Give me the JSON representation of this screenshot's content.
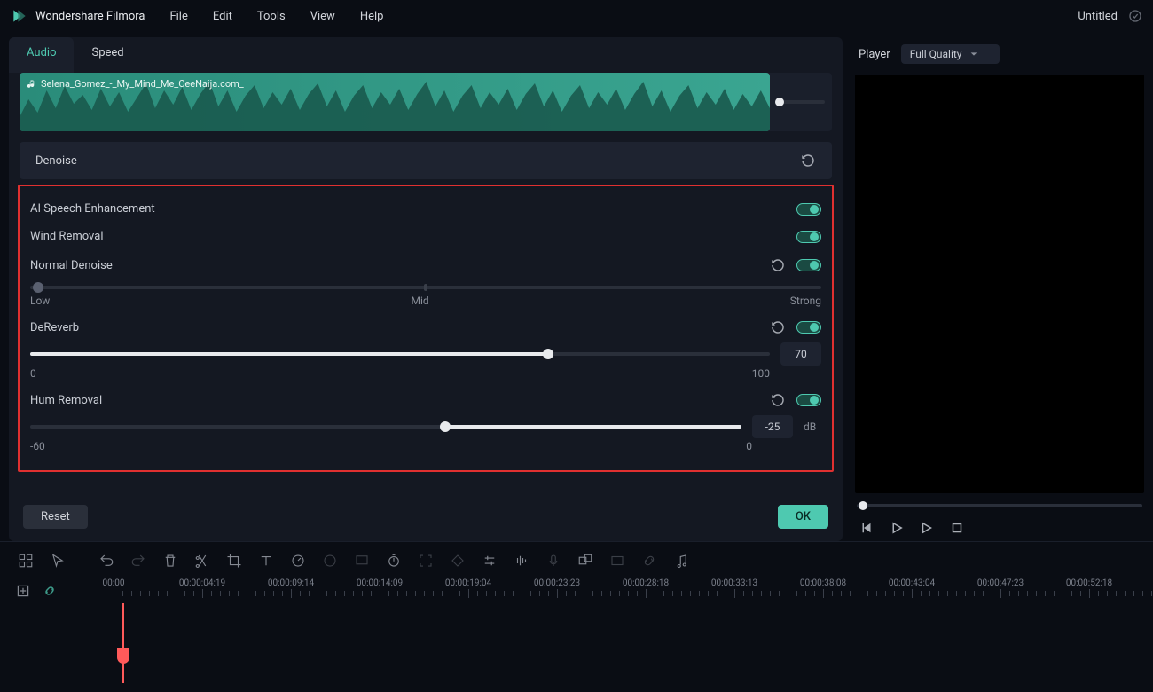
{
  "app": {
    "title": "Wondershare Filmora"
  },
  "menu": {
    "file": "File",
    "edit": "Edit",
    "tools": "Tools",
    "view": "View",
    "help": "Help"
  },
  "doc": {
    "title": "Untitled"
  },
  "tabs": {
    "audio": "Audio",
    "speed": "Speed"
  },
  "clip": {
    "filename": "Selena_Gomez_-_My_Mind_Me_CeeNaija.com_"
  },
  "denoise": {
    "header": "Denoise",
    "ai_speech": {
      "label": "AI Speech Enhancement",
      "on": true
    },
    "wind": {
      "label": "Wind Removal",
      "on": true
    },
    "normal": {
      "label": "Normal Denoise",
      "on": true,
      "low": "Low",
      "mid": "Mid",
      "strong": "Strong"
    },
    "dereverb": {
      "label": "DeReverb",
      "on": true,
      "value": "70",
      "min": "0",
      "max": "100"
    },
    "hum": {
      "label": "Hum Removal",
      "on": true,
      "value": "-25",
      "unit": "dB",
      "min": "-60",
      "max": "0"
    }
  },
  "footer": {
    "reset": "Reset",
    "ok": "OK"
  },
  "player": {
    "label": "Player",
    "quality": "Full Quality"
  },
  "timeline": {
    "marks": [
      {
        "t": "00:00",
        "pos": 0
      },
      {
        "t": "00:00:04:19",
        "pos": 100
      },
      {
        "t": "00:00:09:14",
        "pos": 200
      },
      {
        "t": "00:00:14:09",
        "pos": 300
      },
      {
        "t": "00:00:19:04",
        "pos": 400
      },
      {
        "t": "00:00:23:23",
        "pos": 500
      },
      {
        "t": "00:00:28:18",
        "pos": 600
      },
      {
        "t": "00:00:33:13",
        "pos": 700
      },
      {
        "t": "00:00:38:08",
        "pos": 800
      },
      {
        "t": "00:00:43:04",
        "pos": 900
      },
      {
        "t": "00:00:47:23",
        "pos": 1000
      },
      {
        "t": "00:00:52:18",
        "pos": 1100
      }
    ]
  }
}
